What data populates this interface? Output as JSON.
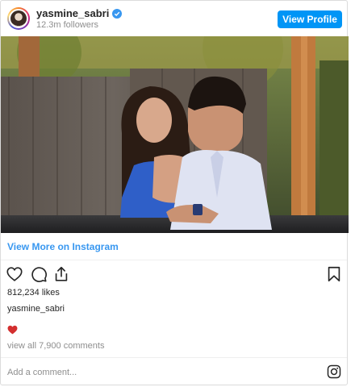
{
  "header": {
    "username": "yasmine_sabri",
    "followers": "12.3m followers",
    "view_profile_label": "View Profile",
    "verified_icon": "verified-badge-icon"
  },
  "post": {
    "view_more_label": "View More on Instagram",
    "likes": "812,234 likes",
    "caption_username": "yasmine_sabri",
    "caption_emoji": "red-heart",
    "comments_link": "view all 7,900 comments",
    "add_comment_placeholder": "Add a comment..."
  },
  "actions": [
    "heart-icon",
    "comment-icon",
    "share-icon",
    "bookmark-icon"
  ],
  "colors": {
    "accent": "#0095f6",
    "link": "#3897f0",
    "muted": "#8e8e8e",
    "heart": "#ed4956"
  }
}
